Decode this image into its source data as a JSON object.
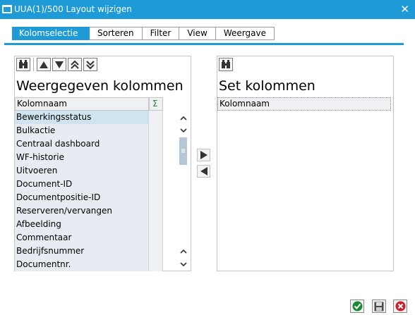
{
  "window": {
    "title": "UUA(1)/500 Layout wijzigen",
    "close_glyph": "✕"
  },
  "tabs": [
    {
      "label": "Kolomselectie",
      "active": true
    },
    {
      "label": "Sorteren",
      "active": false
    },
    {
      "label": "Filter",
      "active": false
    },
    {
      "label": "View",
      "active": false
    },
    {
      "label": "Weergave",
      "active": false
    }
  ],
  "left_panel": {
    "title": "Weergegeven kolommen",
    "toolbar_icons": [
      "binoculars-icon",
      "move-up-icon",
      "move-down-icon",
      "move-to-top-icon",
      "move-to-bottom-icon"
    ],
    "column_header": "Kolomnaam",
    "sum_header": "Σ",
    "rows": [
      "Bewerkingsstatus",
      "Bulkactie",
      "Centraal dashboard",
      "WF-historie",
      "Uitvoeren",
      "Document-ID",
      "Documentpositie-ID",
      "Reserveren/vervangen",
      "Afbeelding",
      "Commentaar",
      "Bedrijfsnummer",
      "Documentnr."
    ],
    "selected_row": 0
  },
  "right_panel": {
    "title": "Set kolommen",
    "toolbar_icons": [
      "binoculars-icon"
    ],
    "column_header": "Kolomnaam"
  },
  "transfer_buttons": [
    "move-right-icon",
    "move-left-icon"
  ],
  "footer_buttons": [
    "confirm-icon",
    "save-icon",
    "cancel-icon"
  ],
  "colors": {
    "accent": "#1e9ad6",
    "selected_row": "#cfe4f0",
    "confirm": "#1a8a3a",
    "cancel": "#c8202a"
  }
}
